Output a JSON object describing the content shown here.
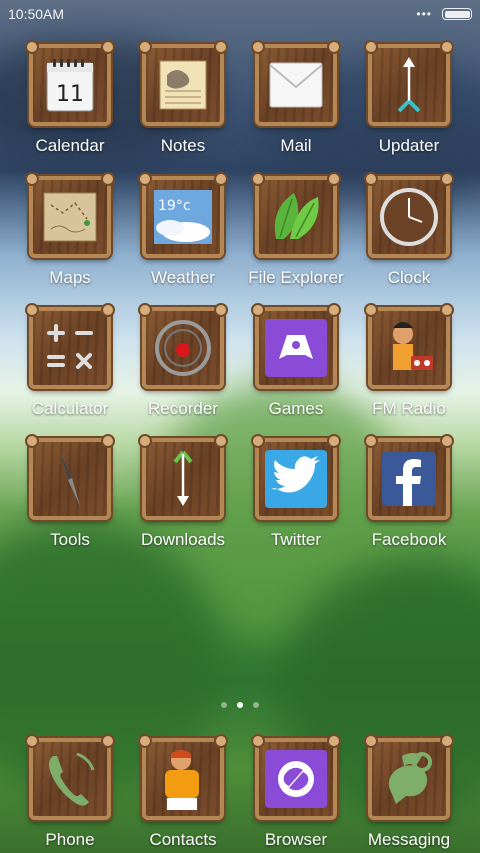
{
  "status_bar": {
    "time": "10:50AM",
    "more": "•••",
    "battery_level": 1.0
  },
  "apps": [
    {
      "label": "Calendar",
      "icon": "calendar-icon",
      "day": "11"
    },
    {
      "label": "Notes",
      "icon": "notes-icon"
    },
    {
      "label": "Mail",
      "icon": "mail-icon"
    },
    {
      "label": "Updater",
      "icon": "arrow-up-icon"
    },
    {
      "label": "Maps",
      "icon": "map-icon"
    },
    {
      "label": "Weather",
      "icon": "weather-icon",
      "temp": "19°c"
    },
    {
      "label": "File Explorer",
      "icon": "leaf-icon"
    },
    {
      "label": "Clock",
      "icon": "clock-icon"
    },
    {
      "label": "Calculator",
      "icon": "calculator-icon"
    },
    {
      "label": "Recorder",
      "icon": "recorder-icon"
    },
    {
      "label": "Games",
      "icon": "gamepad-icon"
    },
    {
      "label": "FM Radio",
      "icon": "radio-character-icon"
    },
    {
      "label": "Tools",
      "icon": "compass-needle-icon"
    },
    {
      "label": "Downloads",
      "icon": "arrow-down-icon"
    },
    {
      "label": "Twitter",
      "icon": "twitter-icon"
    },
    {
      "label": "Facebook",
      "icon": "facebook-icon"
    }
  ],
  "dock": [
    {
      "label": "Phone",
      "icon": "phone-icon"
    },
    {
      "label": "Contacts",
      "icon": "contacts-character-icon"
    },
    {
      "label": "Browser",
      "icon": "browser-icon"
    },
    {
      "label": "Messaging",
      "icon": "messaging-icon"
    }
  ],
  "page_indicator": {
    "count": 3,
    "active_index": 1
  }
}
